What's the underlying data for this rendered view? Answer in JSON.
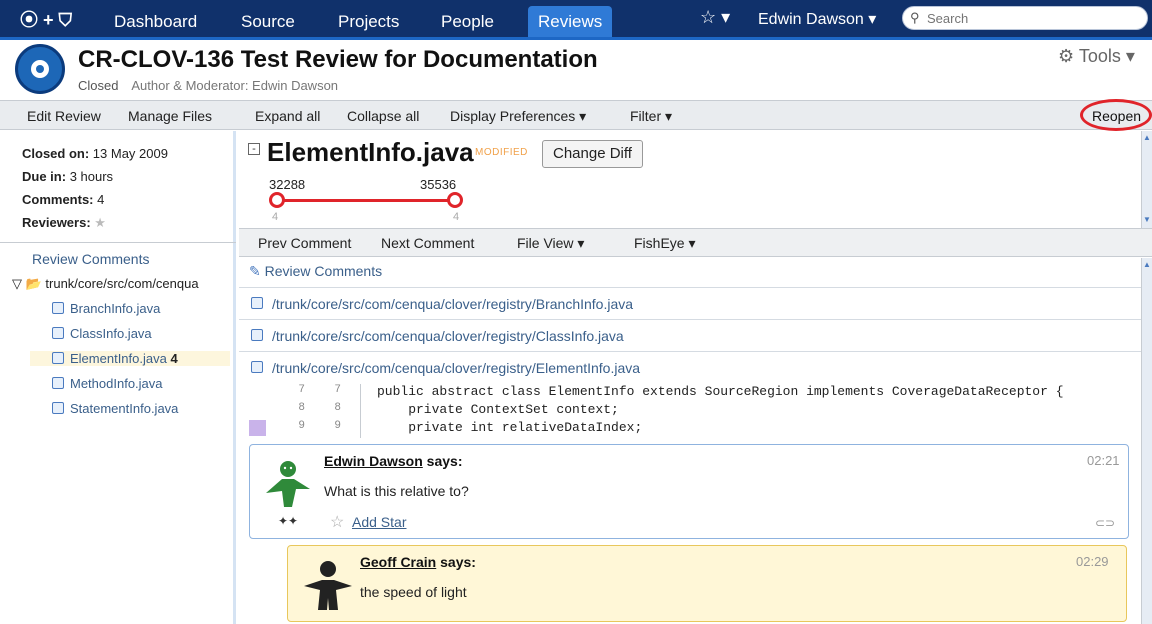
{
  "nav": {
    "logo": "⦿ + ⛉",
    "items": [
      "Dashboard",
      "Source",
      "Projects",
      "People",
      "Reviews"
    ],
    "star": "☆ ▾",
    "user": "Edwin Dawson ▾",
    "search_placeholder": "Search"
  },
  "header": {
    "title": "CR-CLOV-136 Test Review for Documentation",
    "status": "Closed",
    "author": "Author & Moderator: Edwin Dawson",
    "tools": "⚙ Tools ▾"
  },
  "toolbar": {
    "edit_review": "Edit Review",
    "manage_files": "Manage Files",
    "expand_all": "Expand all",
    "collapse_all": "Collapse all",
    "display_prefs": "Display Preferences ▾",
    "filter": "Filter ▾",
    "reopen": "Reopen"
  },
  "sidebar": {
    "closed_label": "Closed on:",
    "closed_value": "13 May 2009",
    "due_label": "Due in:",
    "due_value": "3 hours",
    "comments_label": "Comments:",
    "comments_value": "4",
    "reviewers_label": "Reviewers:",
    "reviewers_star": "★",
    "review_comments": "Review Comments",
    "folder": "▽ 📂 trunk/core/src/com/cenqua",
    "files": [
      "BranchInfo.java",
      "ClassInfo.java",
      "ElementInfo.java",
      "MethodInfo.java",
      "StatementInfo.java"
    ],
    "selected_count": "4"
  },
  "file": {
    "collapse": "-",
    "name": "ElementInfo.java",
    "status": "MODIFIED",
    "change_diff": "Change Diff",
    "rev_from": "32288",
    "rev_to": "35536",
    "count_from": "4",
    "count_to": "4"
  },
  "subtool": {
    "prev": "Prev Comment",
    "next": "Next Comment",
    "file_view": "File View ▾",
    "fisheye": "FishEye ▾"
  },
  "comments": {
    "head": "Review Comments",
    "paths": [
      "/trunk/core/src/com/cenqua/clover/registry/BranchInfo.java",
      "/trunk/core/src/com/cenqua/clover/registry/ClassInfo.java",
      "/trunk/core/src/com/cenqua/clover/registry/ElementInfo.java"
    ],
    "code": [
      {
        "a": "7",
        "b": "7",
        "text": "public abstract class ElementInfo extends SourceRegion implements CoverageDataReceptor {"
      },
      {
        "a": "8",
        "b": "8",
        "text": "    private ContextSet context;"
      },
      {
        "a": "9",
        "b": "9",
        "text": "    private int relativeDataIndex;"
      }
    ],
    "c1": {
      "author": "Edwin Dawson",
      "says": " says:",
      "body": "What is this relative to?",
      "time": "02:21",
      "add_star": "Add Star",
      "vote": "✦✦",
      "link": "⊂⊃",
      "star": "☆"
    },
    "c2": {
      "author": "Geoff Crain",
      "says": " says:",
      "body": "the speed of light",
      "time": "02:29"
    }
  }
}
